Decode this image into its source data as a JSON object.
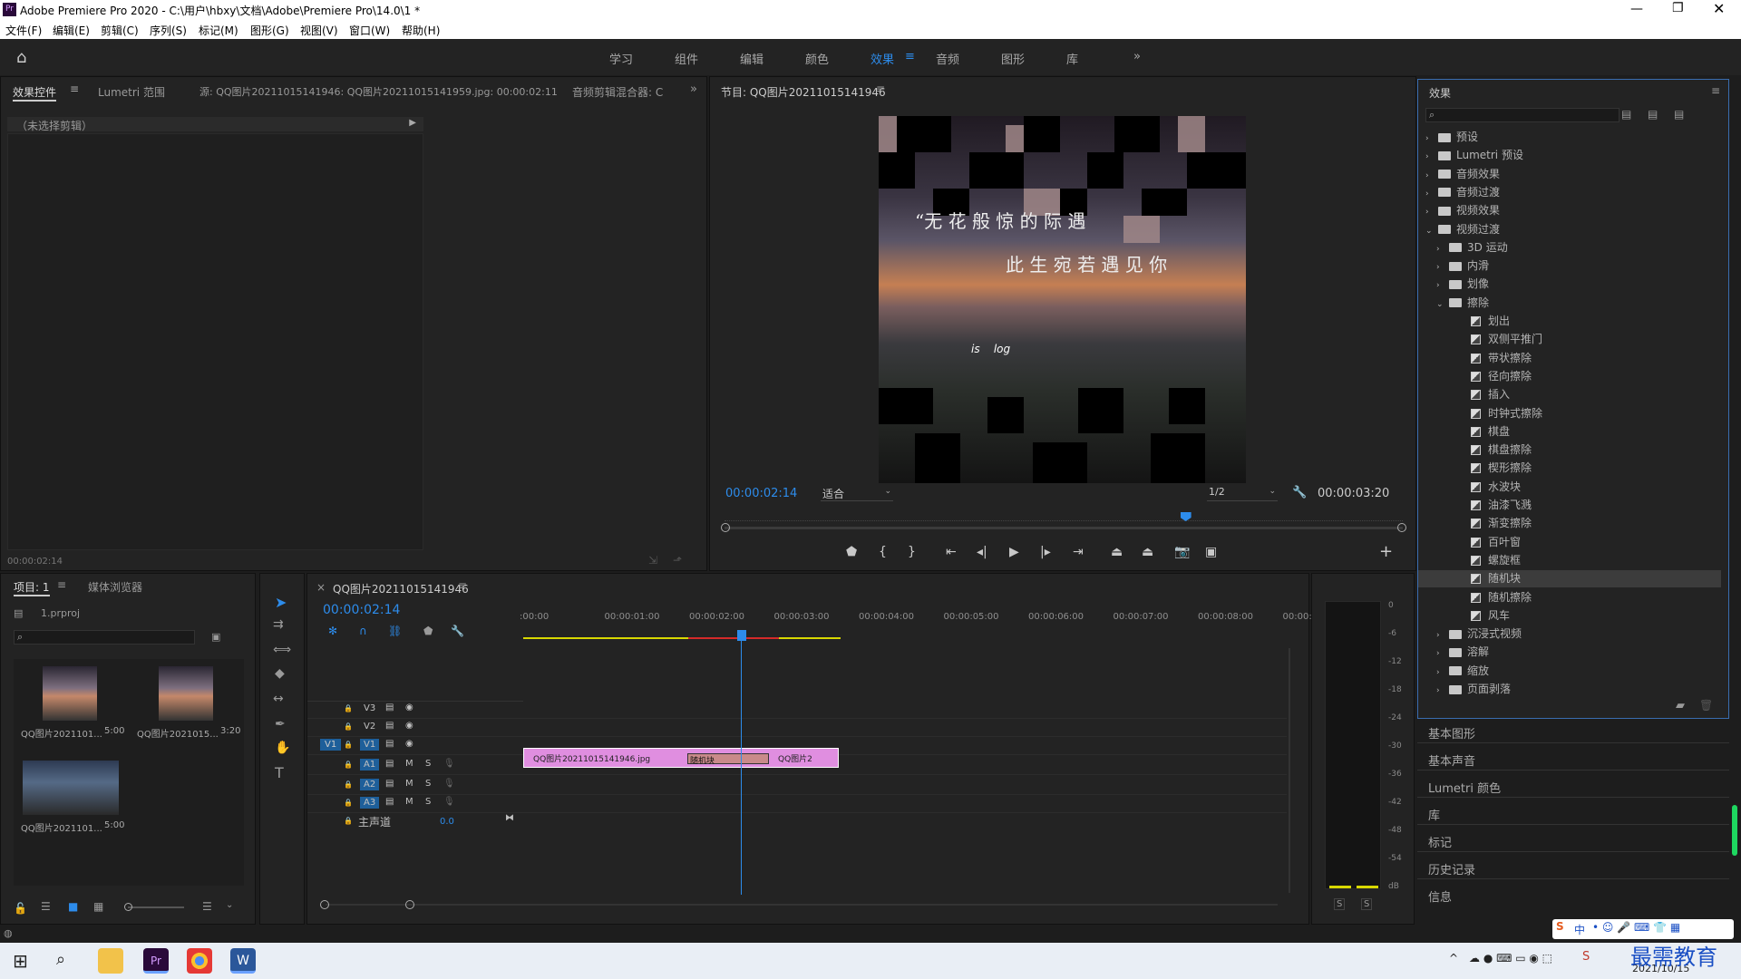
{
  "window": {
    "title": "Adobe Premiere Pro 2020 - C:\\用户\\hbxy\\文档\\Adobe\\Premiere Pro\\14.0\\1 *",
    "app_icon": "Pr"
  },
  "menu": [
    "文件(F)",
    "编辑(E)",
    "剪辑(C)",
    "序列(S)",
    "标记(M)",
    "图形(G)",
    "视图(V)",
    "窗口(W)",
    "帮助(H)"
  ],
  "workspaces": [
    "学习",
    "组件",
    "编辑",
    "颜色",
    "效果",
    "音频",
    "图形",
    "库"
  ],
  "active_workspace": "效果",
  "source_panel": {
    "tabs": [
      "效果控件",
      "Lumetri 范围",
      "源: QQ图片20211015141946: QQ图片20211015141959.jpg: 00:00:02:11",
      "音频剪辑混合器: C"
    ],
    "no_clip": "（未选择剪辑）",
    "timecode": "00:00:02:14"
  },
  "program_monitor": {
    "title": "节目: QQ图片20211015141946",
    "timecode": "00:00:02:14",
    "fit": "适合",
    "quality": "1/2",
    "duration": "00:00:03:20",
    "caption_line1": "“无 花 般 惊    的 际 遇",
    "caption_line2": "此 生 宛 若 遇 见 你",
    "caption_line3": "is    log",
    "playhead_fraction": 0.68
  },
  "project_panel": {
    "tabs": [
      "项目: 1",
      "媒体浏览器"
    ],
    "file": "1.prproj",
    "items": [
      {
        "name": "QQ图片2021101...",
        "dur": "5:00"
      },
      {
        "name": "QQ图片2021015...",
        "dur": "3:20"
      },
      {
        "name": "QQ图片2021101...",
        "dur": "5:00"
      }
    ]
  },
  "timeline": {
    "tab": "QQ图片20211015141946",
    "timecode": "00:00:02:14",
    "ruler": [
      ":00:00",
      "00:00:01:00",
      "00:00:02:00",
      "00:00:03:00",
      "00:00:04:00",
      "00:00:05:00",
      "00:00:06:00",
      "00:00:07:00",
      "00:00:08:00",
      "00:00:09:"
    ],
    "video_tracks": [
      "V3",
      "V2",
      "V1"
    ],
    "audio_tracks": [
      "A1",
      "A2",
      "A3"
    ],
    "master": "主声道",
    "master_val": "0.0",
    "clip1": "QQ图片20211015141946.jpg",
    "transition": "随机块",
    "clip2": "QQ图片2",
    "source_patch": "V1"
  },
  "meter": {
    "scale": [
      "0",
      "-6",
      "-12",
      "-18",
      "-24",
      "-30",
      "-36",
      "-42",
      "-48",
      "-54",
      "dB"
    ],
    "solo": [
      "S",
      "S"
    ]
  },
  "effects_panel": {
    "title": "效果",
    "tree": [
      {
        "label": "预设",
        "level": 0,
        "type": "folder",
        "open": false
      },
      {
        "label": "Lumetri 预设",
        "level": 0,
        "type": "folder",
        "open": false
      },
      {
        "label": "音频效果",
        "level": 0,
        "type": "folder",
        "open": false
      },
      {
        "label": "音频过渡",
        "level": 0,
        "type": "folder",
        "open": false
      },
      {
        "label": "视频效果",
        "level": 0,
        "type": "folder",
        "open": false
      },
      {
        "label": "视频过渡",
        "level": 0,
        "type": "folder",
        "open": true
      },
      {
        "label": "3D 运动",
        "level": 1,
        "type": "folder",
        "open": false
      },
      {
        "label": "内滑",
        "level": 1,
        "type": "folder",
        "open": false
      },
      {
        "label": "划像",
        "level": 1,
        "type": "folder",
        "open": false
      },
      {
        "label": "擦除",
        "level": 1,
        "type": "folder",
        "open": true
      },
      {
        "label": "划出",
        "level": 2,
        "type": "fx"
      },
      {
        "label": "双侧平推门",
        "level": 2,
        "type": "fx"
      },
      {
        "label": "带状擦除",
        "level": 2,
        "type": "fx"
      },
      {
        "label": "径向擦除",
        "level": 2,
        "type": "fx"
      },
      {
        "label": "插入",
        "level": 2,
        "type": "fx"
      },
      {
        "label": "时钟式擦除",
        "level": 2,
        "type": "fx"
      },
      {
        "label": "棋盘",
        "level": 2,
        "type": "fx"
      },
      {
        "label": "棋盘擦除",
        "level": 2,
        "type": "fx"
      },
      {
        "label": "楔形擦除",
        "level": 2,
        "type": "fx"
      },
      {
        "label": "水波块",
        "level": 2,
        "type": "fx"
      },
      {
        "label": "油漆飞溅",
        "level": 2,
        "type": "fx"
      },
      {
        "label": "渐变擦除",
        "level": 2,
        "type": "fx"
      },
      {
        "label": "百叶窗",
        "level": 2,
        "type": "fx"
      },
      {
        "label": "螺旋框",
        "level": 2,
        "type": "fx"
      },
      {
        "label": "随机块",
        "level": 2,
        "type": "fx",
        "selected": true
      },
      {
        "label": "随机擦除",
        "level": 2,
        "type": "fx"
      },
      {
        "label": "风车",
        "level": 2,
        "type": "fx"
      },
      {
        "label": "沉浸式视频",
        "level": 1,
        "type": "folder",
        "open": false
      },
      {
        "label": "溶解",
        "level": 1,
        "type": "folder",
        "open": false
      },
      {
        "label": "缩放",
        "level": 1,
        "type": "folder",
        "open": false
      },
      {
        "label": "页面剥落",
        "level": 1,
        "type": "folder",
        "open": false
      }
    ],
    "collapsed_panels": [
      "基本图形",
      "基本声音",
      "Lumetri 颜色",
      "库",
      "标记",
      "历史记录",
      "信息"
    ]
  },
  "taskbar": {
    "date": "2021/10/15",
    "watermark": "最需教育",
    "ime": "中"
  }
}
